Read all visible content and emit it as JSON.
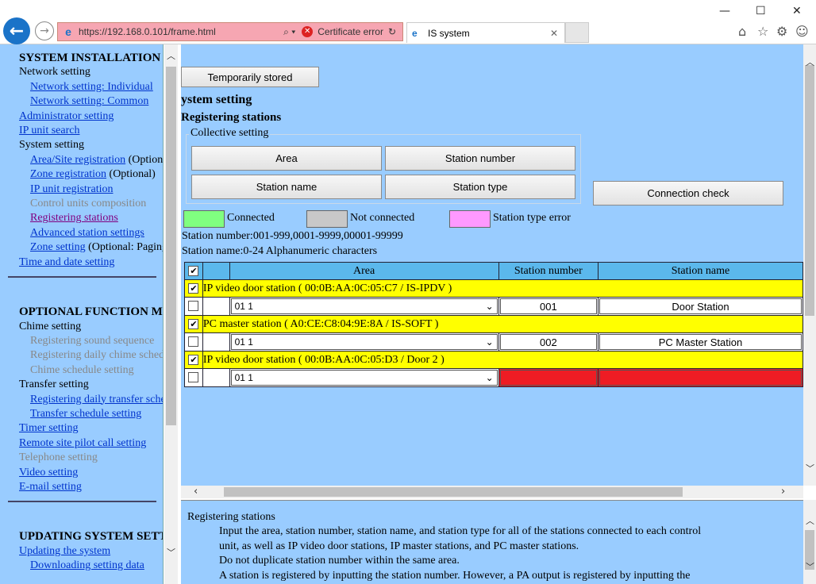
{
  "browser": {
    "url": "https://192.168.0.101/frame.html",
    "cert_error": "Certificate error",
    "tab_title": "IS system",
    "search_glyph": "⌕ ▾",
    "refresh_glyph": "↻"
  },
  "sidebar": {
    "installation": {
      "heading": "SYSTEM INSTALLATION",
      "network": "Network setting",
      "net_individual": "Network setting: Individual",
      "net_common": "Network setting: Common",
      "admin": "Administrator setting",
      "ipsearch": "IP unit search",
      "system": "System setting",
      "area_site": "Area/Site registration",
      "area_site_note": "(Optional)",
      "zone_reg": "Zone registration",
      "zone_reg_note": "(Optional)",
      "ipunit": "IP unit registration",
      "control_units": "Control units composition",
      "registering": "Registering stations",
      "advanced": "Advanced station settings",
      "zone_setting": "Zone setting",
      "zone_setting_note": "(Optional: Paging)",
      "timedate": "Time and date setting"
    },
    "optional": {
      "heading": "OPTIONAL FUNCTION MENU",
      "chime": "Chime setting",
      "reg_sound": "Registering sound sequence",
      "reg_daily_chime": "Registering daily chime schedule",
      "chime_sched": "Chime schedule setting",
      "transfer": "Transfer setting",
      "reg_daily_transfer": "Registering daily transfer schedule",
      "transfer_sched": "Transfer schedule setting",
      "timer": "Timer setting",
      "remote": "Remote site pilot call setting",
      "telephone": "Telephone setting",
      "video": "Video setting",
      "email": "E-mail setting"
    },
    "updating": {
      "heading": "UPDATING SYSTEM SETTINGS",
      "update": "Updating the system",
      "download": "Downloading setting data"
    }
  },
  "main": {
    "temp_stored": "Temporarily stored",
    "section_title": "ystem setting",
    "sub_title": "Registering stations",
    "collective": {
      "legend": "Collective setting",
      "area": "Area",
      "station_number": "Station number",
      "station_name": "Station name",
      "station_type": "Station type"
    },
    "connection_check": "Connection check",
    "legend": {
      "connected": "Connected",
      "not_connected": "Not connected",
      "type_error": "Station type error",
      "colors": {
        "connected": "#80ff80",
        "not_connected": "#c8c8c8",
        "type_error": "#ff99ff"
      }
    },
    "hint_number": "Station number:001-999,0001-9999,00001-99999",
    "hint_name": "Station name:0-24 Alphanumeric characters",
    "table": {
      "headers": {
        "area": "Area",
        "number": "Station number",
        "name": "Station name"
      },
      "check_all": "✔",
      "groups": [
        {
          "title": "IP video door station ( 00:0B:AA:0C:05:C7 / IS-IPDV )",
          "area": "01 1",
          "number": "001",
          "name": "Door Station",
          "error": false
        },
        {
          "title": "PC master station ( A0:CE:C8:04:9E:8A / IS-SOFT )",
          "area": "01 1",
          "number": "002",
          "name": "PC Master Station",
          "error": false
        },
        {
          "title": "IP video door station ( 00:0B:AA:0C:05:D3 / Door 2 )",
          "area": "01 1",
          "number": "",
          "name": "",
          "error": true
        }
      ]
    }
  },
  "help": {
    "title": "Registering stations",
    "p1": "Input the area, station number, station name, and station type for all of the stations connected to each control",
    "p1b": "unit, as well as IP video door stations, IP master stations, and PC master stations.",
    "p2": "Do not duplicate station number within the same area.",
    "p3": "A station is registered by inputting the station number. However, a PA output is registered by inputting the"
  }
}
